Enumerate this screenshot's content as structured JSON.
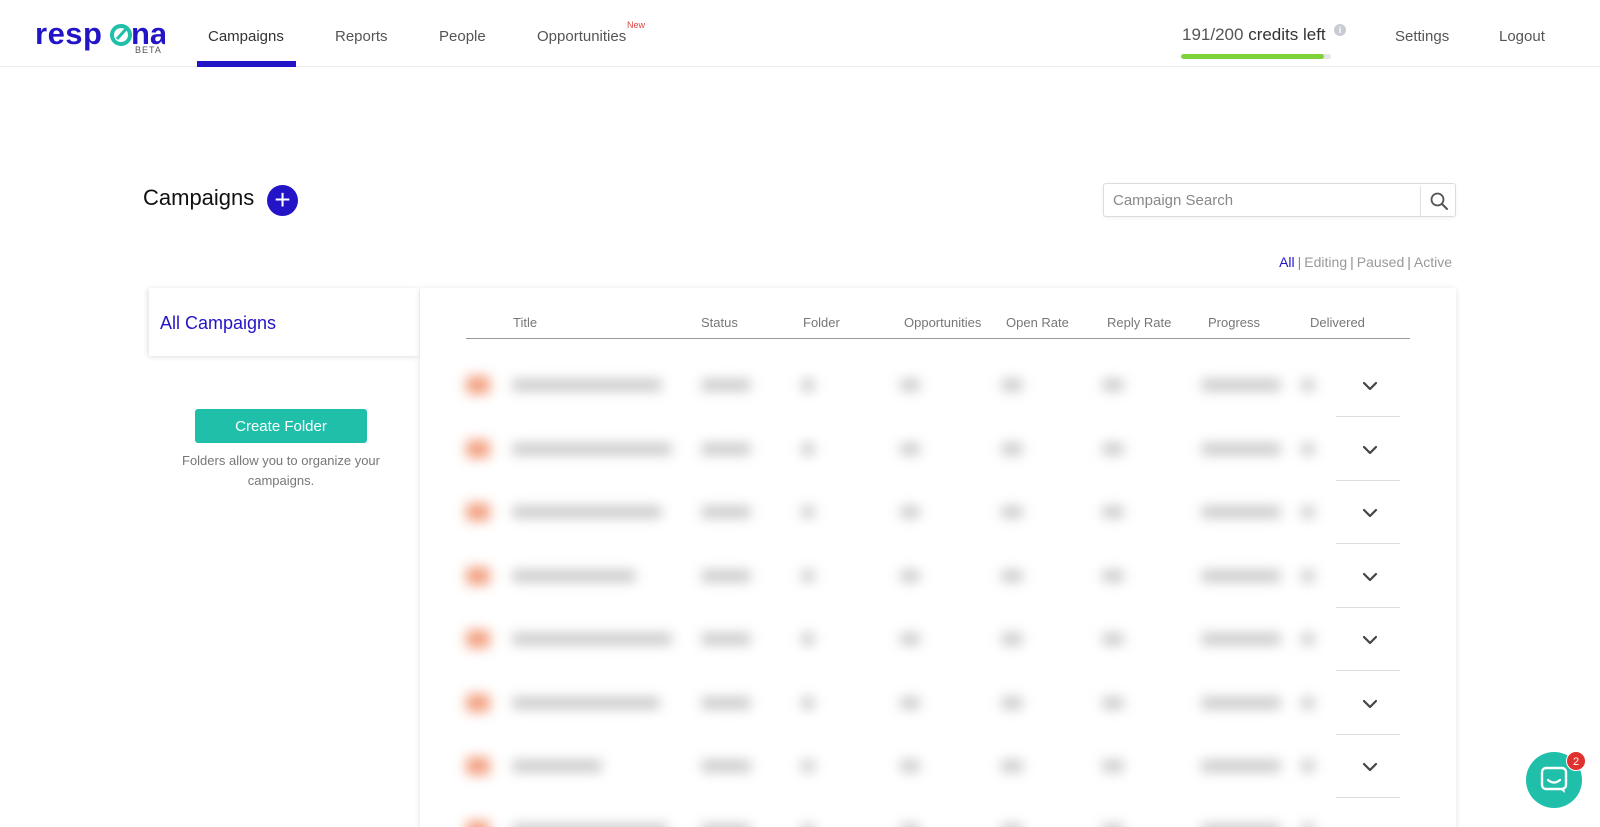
{
  "nav": {
    "logo": "respona",
    "logo_badge": "BETA",
    "items": [
      {
        "label": "Campaigns"
      },
      {
        "label": "Reports"
      },
      {
        "label": "People"
      },
      {
        "label": "Opportunities"
      }
    ],
    "active_item": "Campaigns",
    "new_badge": "New",
    "credits_used": "191/200",
    "credits_suffix": "credits left",
    "credits_fraction": 0.955,
    "info_icon": "i",
    "settings": "Settings",
    "logout": "Logout"
  },
  "page": {
    "title": "Campaigns",
    "add_icon": "+",
    "search_placeholder": "Campaign Search",
    "filters": [
      "All",
      "Editing",
      "Paused",
      "Active"
    ],
    "active_filter": "All"
  },
  "folders": {
    "all_label": "All Campaigns",
    "create_button": "Create Folder",
    "hint": "Folders allow you to organize your campaigns."
  },
  "table": {
    "columns": [
      "Title",
      "Status",
      "Folder",
      "Opportunities",
      "Open Rate",
      "Reply Rate",
      "Progress",
      "Delivered"
    ],
    "row_count": 8
  },
  "chat": {
    "badge_count": "2"
  },
  "colors": {
    "brand": "#2414c8",
    "teal": "#1fbfaa",
    "credit_green": "#7ed338",
    "new_red": "#e0443e"
  }
}
